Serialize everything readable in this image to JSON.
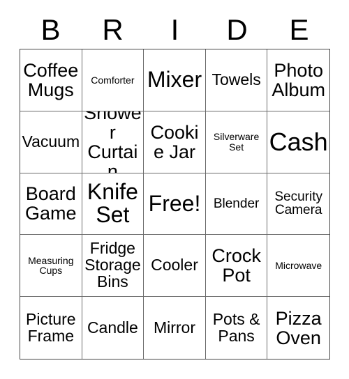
{
  "card": {
    "title": "BRIDE",
    "header_letters": [
      "B",
      "R",
      "I",
      "D",
      "E"
    ],
    "grid_size": "5x5",
    "free_space": "Free!",
    "colors": {
      "background": "#ffffff",
      "text": "#000000",
      "inner_border": "#6a6a6a",
      "outer_border": "#444444"
    },
    "rows": [
      [
        {
          "text": "Coffee Mugs",
          "size": "lg"
        },
        {
          "text": "Comforter",
          "size": "xs"
        },
        {
          "text": "Mixer",
          "size": "xl"
        },
        {
          "text": "Towels",
          "size": "md"
        },
        {
          "text": "Photo Album",
          "size": "lg"
        }
      ],
      [
        {
          "text": "Vacuum",
          "size": "md"
        },
        {
          "text": "Shower Curtain",
          "size": "lg"
        },
        {
          "text": "Cookie Jar",
          "size": "lg"
        },
        {
          "text": "Silverware Set",
          "size": "xs"
        },
        {
          "text": "Cash",
          "size": "xxl"
        }
      ],
      [
        {
          "text": "Board Game",
          "size": "lg"
        },
        {
          "text": "Knife Set",
          "size": "xl"
        },
        {
          "text": "Free!",
          "size": "xl"
        },
        {
          "text": "Blender",
          "size": "sm"
        },
        {
          "text": "Security Camera",
          "size": "sm"
        }
      ],
      [
        {
          "text": "Measuring Cups",
          "size": "xs"
        },
        {
          "text": "Fridge Storage Bins",
          "size": "md"
        },
        {
          "text": "Cooler",
          "size": "md"
        },
        {
          "text": "Crock Pot",
          "size": "lg"
        },
        {
          "text": "Microwave",
          "size": "xs"
        }
      ],
      [
        {
          "text": "Picture Frame",
          "size": "md"
        },
        {
          "text": "Candle",
          "size": "md"
        },
        {
          "text": "Mirror",
          "size": "md"
        },
        {
          "text": "Pots & Pans",
          "size": "md"
        },
        {
          "text": "Pizza Oven",
          "size": "lg"
        }
      ]
    ]
  }
}
